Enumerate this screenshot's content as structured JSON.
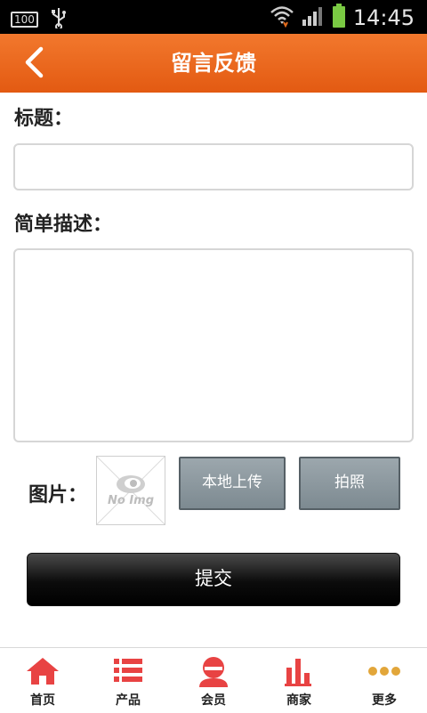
{
  "status_bar": {
    "battery_small": "100",
    "time": "14:45"
  },
  "header": {
    "title": "留言反馈"
  },
  "form": {
    "title_label": "标题：",
    "title_value": "",
    "desc_label": "简单描述：",
    "desc_value": "",
    "image_label": "图片：",
    "no_image_text": "No Img",
    "upload_local": "本地上传",
    "take_photo": "拍照",
    "submit": "提交"
  },
  "tabs": [
    {
      "label": "首页",
      "icon": "home-icon"
    },
    {
      "label": "产品",
      "icon": "list-icon"
    },
    {
      "label": "会员",
      "icon": "member-icon"
    },
    {
      "label": "商家",
      "icon": "bar-chart-icon"
    },
    {
      "label": "更多",
      "icon": "more-icon"
    }
  ],
  "colors": {
    "accent": "#e8601a",
    "tab_icon": "#e84343"
  }
}
